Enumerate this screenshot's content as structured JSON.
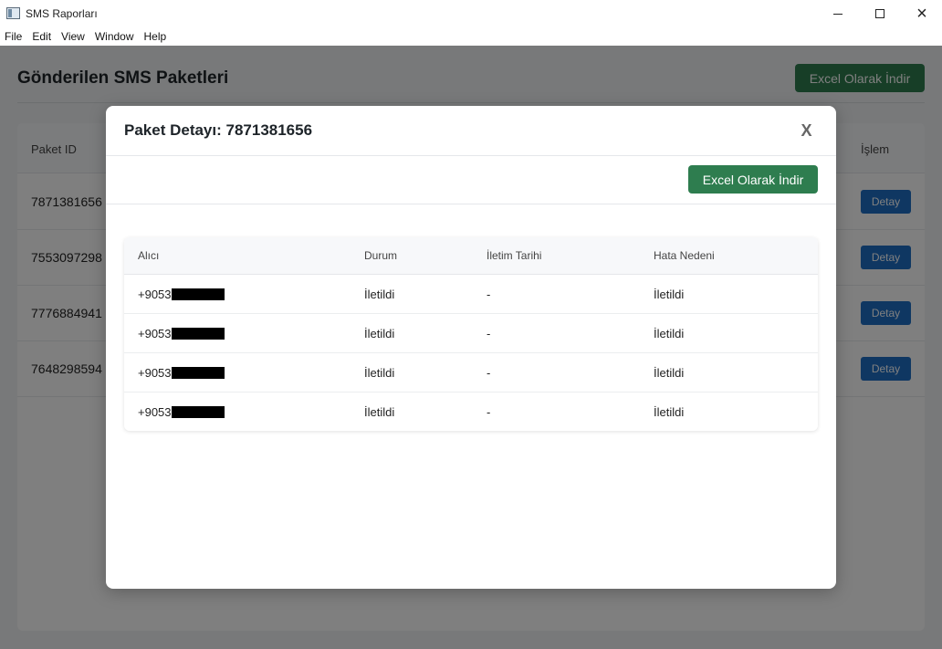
{
  "window": {
    "title": "SMS Raporları",
    "controls": {
      "minimize": "minimize-icon",
      "maximize": "maximize-icon",
      "close": "×"
    }
  },
  "menu": [
    "File",
    "Edit",
    "View",
    "Window",
    "Help"
  ],
  "page": {
    "title": "Gönderilen SMS Paketleri",
    "excel_label": "Excel Olarak İndir",
    "columns": {
      "id": "Paket ID",
      "action": "İşlem"
    },
    "packages": [
      {
        "id": "7871381656",
        "action": "Detay"
      },
      {
        "id": "7553097298",
        "action": "Detay"
      },
      {
        "id": "7776884941",
        "action": "Detay"
      },
      {
        "id": "7648298594",
        "action": "Detay"
      }
    ]
  },
  "modal": {
    "title": "Paket Detayı: 7871381656",
    "close_label": "X",
    "excel_label": "Excel Olarak İndir",
    "columns": [
      "Alıcı",
      "Durum",
      "İletim Tarihi",
      "Hata Nedeni"
    ],
    "rows": [
      {
        "recipient_prefix": "+9053",
        "status": "İletildi",
        "date": "-",
        "reason": "İletildi"
      },
      {
        "recipient_prefix": "+9053",
        "status": "İletildi",
        "date": "-",
        "reason": "İletildi"
      },
      {
        "recipient_prefix": "+9053",
        "status": "İletildi",
        "date": "-",
        "reason": "İletildi"
      },
      {
        "recipient_prefix": "+9053",
        "status": "İletildi",
        "date": "-",
        "reason": "İletildi"
      }
    ]
  },
  "colors": {
    "success_green": "#2e7d4f",
    "status_green": "#2e8b4f",
    "primary_blue": "#1f6fc5",
    "overlay": "rgba(0,0,0,0.5)"
  }
}
